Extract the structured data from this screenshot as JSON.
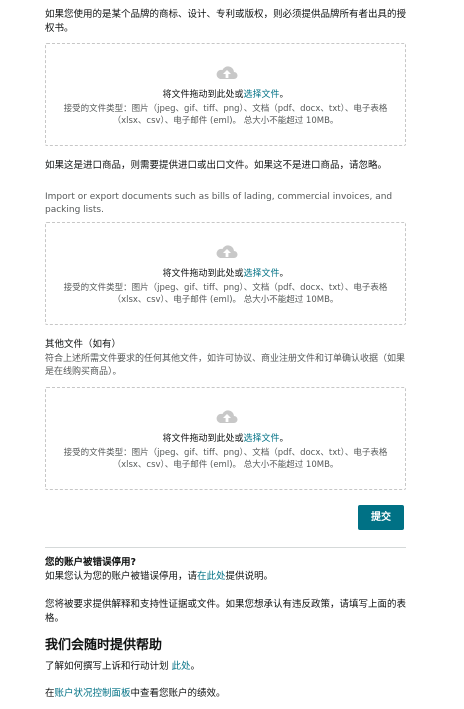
{
  "brand_section": {
    "description": "如果您使用的是某个品牌的商标、设计、专利或版权，则必须提供品牌所有者出具的授权书。"
  },
  "import_section": {
    "description": "如果这是进口商品，则需要提供进口或出口文件。如果这不是进口商品，请忽略。",
    "hint": "Import or export documents such as bills of lading, commercial invoices, and packing lists."
  },
  "other_section": {
    "title": "其他文件（如有）",
    "hint": "符合上述所需文件要求的任何其他文件，如许可协议、商业注册文件和订单确认收据（如果是在线购买商品）。"
  },
  "dropzone": {
    "drag_text": "将文件拖动到此处或",
    "select_link": "选择文件",
    "drag_suffix": "。",
    "accepted_types": "接受的文件类型：图片（jpeg、gif、tiff、png）、文档（pdf、docx、txt）、电子表格（xlsx、csv）、电子邮件 (eml)。 总大小不能超过 10MB。",
    "icon": "cloud-upload-icon"
  },
  "submit_label": "提交",
  "account_section": {
    "title": "您的账户被错误停用?",
    "text_prefix": "如果您认为您的账户被错误停用，请",
    "link": "在此处",
    "text_suffix": "提供说明。",
    "paragraph": "您将被要求提供解释和支持性证据或文件。如果您想承认有违反政策，请填写上面的表格。"
  },
  "help_section": {
    "title": "我们会随时提供帮助",
    "line1_prefix": "了解如何撰写上诉和行动计划 ",
    "line1_link": "此处",
    "line1_suffix": "。",
    "line2_prefix": "在",
    "line2_link": "账户状况控制面板",
    "line2_suffix": "中查看您账户的绩效。"
  },
  "colors": {
    "link": "#007185",
    "button": "#007185",
    "border": "#c7c7c7"
  }
}
